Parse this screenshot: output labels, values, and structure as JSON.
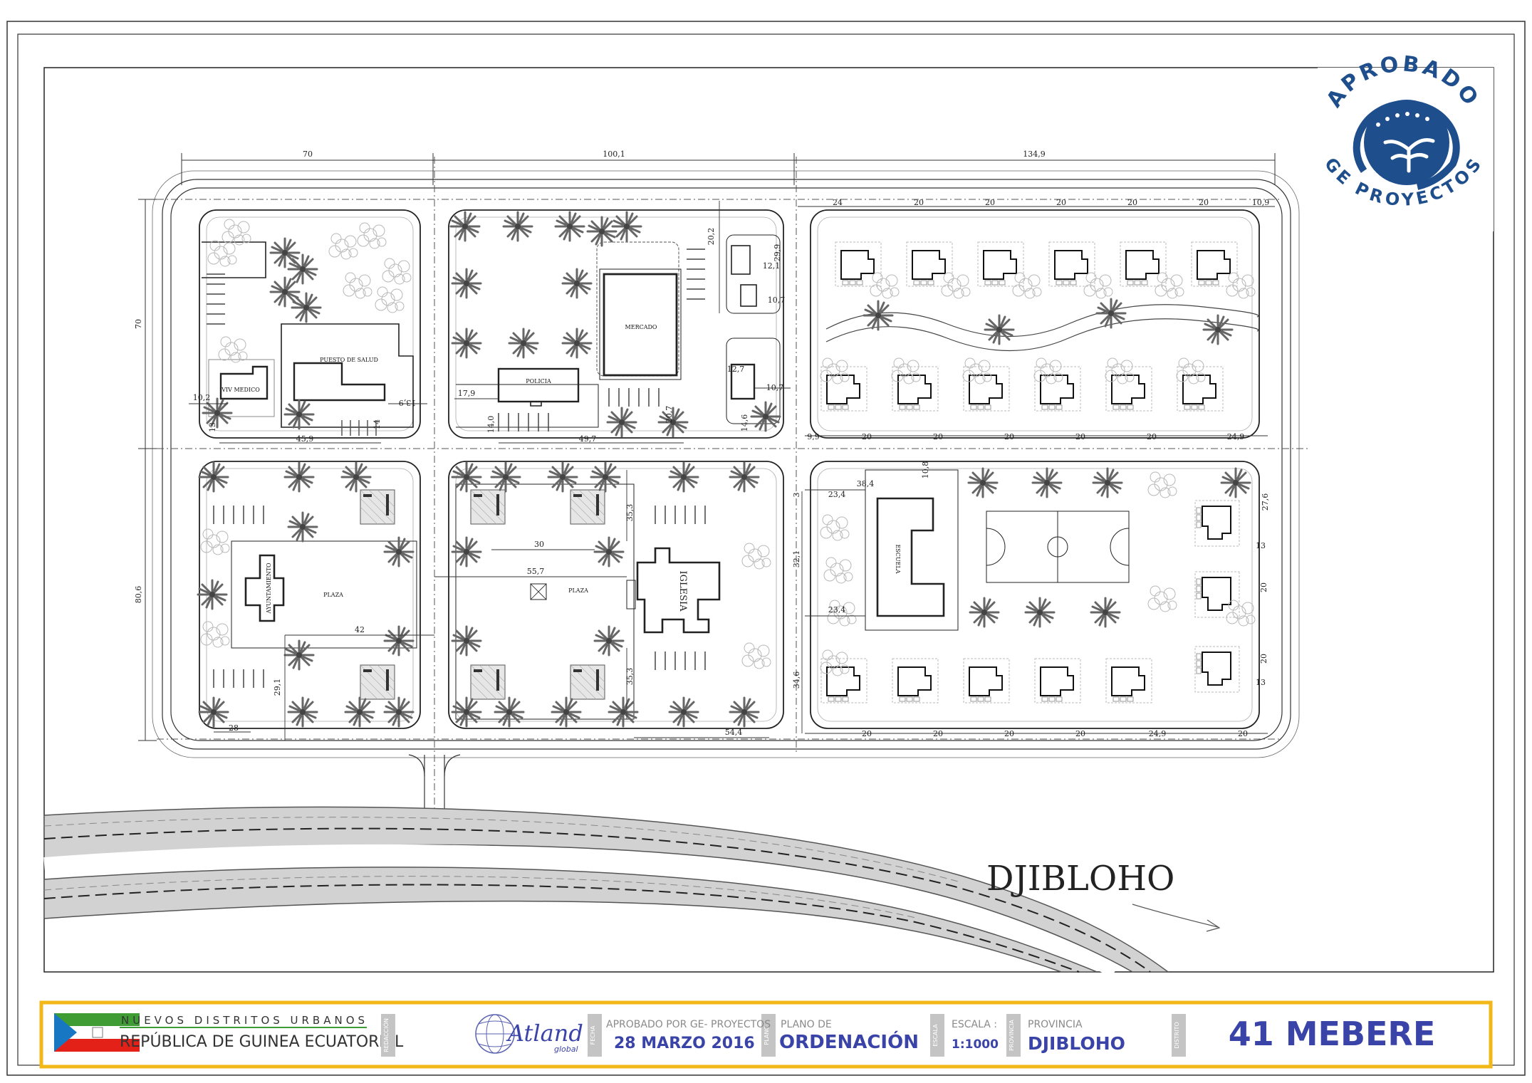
{
  "plan": {
    "location_label": "DJIBLOHO",
    "top_dimensions": [
      "70",
      "100,1",
      "134,9"
    ],
    "left_dimensions": [
      "70",
      "80,6"
    ],
    "labels": {
      "health": "PUESTO DE SALUD",
      "doctor_house": "VIV MEDICO",
      "market": "MERCADO",
      "police": "POLICIA",
      "town_hall": "AYUNTAMIENTO",
      "plaza_left": "PLAZA",
      "plaza_center": "PLAZA",
      "church": "IGLESIA",
      "school": "ESCUELA"
    },
    "dims": {
      "d_10_2": "10,2",
      "d_45_9": "45,9",
      "d_13_9": "13,9",
      "d_14a": "14",
      "d_13a": "13",
      "d_17_9": "17,9",
      "d_49_7": "49,7",
      "d_14b": "14,0",
      "d_20_7a": "20,7",
      "d_14_6": "14,6",
      "d_20_2": "20,2",
      "d_12_1": "12,1",
      "d_29_9": "29,9",
      "d_10_7a": "10,7",
      "d_12_7": "12,7",
      "d_10_7b": "10,7",
      "d_24": "24",
      "d_20": "20",
      "d_13": "13",
      "d_10_9": "10,9",
      "d_9_9": "9,9",
      "d_24_9": "24,9",
      "d_30": "30",
      "d_55_7": "55,7",
      "d_35_3": "35,3",
      "d_42": "42",
      "d_29_1": "29,1",
      "d_28": "28",
      "d_54_4": "54,4",
      "d_38_4": "38,4",
      "d_10_8": "10,8",
      "d_23_4": "23,4",
      "d_32_1": "32,1",
      "d_34_6": "34,6",
      "d_27_6": "27,6",
      "d_3": "3"
    }
  },
  "stamp": {
    "top_text": "APROBADO",
    "bottom_text": "GE PROYECTOS",
    "color": "#1f4e8c"
  },
  "title_block": {
    "program_title": "NUEVOS DISTRITOS URBANOS",
    "country": "REPÚBLICA DE GUINEA ECUATORIAL",
    "redaccion_label": "REDACCIÓN",
    "firm_name": "Atland",
    "firm_sub": "global",
    "fecha_label": "FECHA",
    "approved_by_label": "APROBADO POR GE- PROYECTOS",
    "date": "28 MARZO 2016",
    "plano_label": "PLANO",
    "plan_of_label": "PLANO DE",
    "plan_type": "ORDENACIÓN",
    "escala_vertical": "ESCALA",
    "scale_label": "ESCALA :",
    "scale": "1:1000",
    "provincia_vertical": "PROVINCIA",
    "province_label": "PROVINCIA",
    "province": "DJIBLOHO",
    "distrito_vertical": "DISTRITO",
    "district": "41 MEBERE",
    "colors": {
      "border": "#f2b817",
      "accent": "#3a43a8",
      "label": "#8a8a8a"
    }
  }
}
